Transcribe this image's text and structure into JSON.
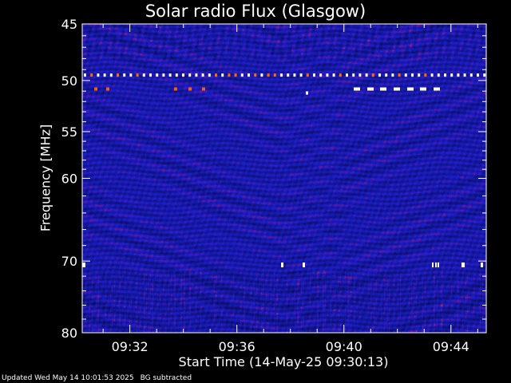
{
  "chart_data": {
    "type": "heatmap",
    "title": "Solar radio Flux (Glasgow)",
    "xlabel": "Start Time (14-May-25 09:30:13)",
    "ylabel": "Frequency [MHz]",
    "x_tick_labels": [
      "09:32",
      "09:36",
      "09:40",
      "09:44"
    ],
    "x_tick_minutes": [
      1.78,
      5.78,
      9.78,
      13.78
    ],
    "xlim_minutes": [
      0,
      15.1
    ],
    "y_ticks": [
      45,
      50,
      55,
      60,
      70,
      80
    ],
    "ylim": [
      80,
      45
    ],
    "minor_y_ticks": [
      46,
      47,
      48,
      49,
      51,
      52,
      53,
      54,
      56,
      57,
      58,
      59,
      62,
      64,
      66,
      68,
      72,
      74,
      76,
      78
    ],
    "colormap": "blue-red-yellow-white",
    "background_color": "#1f1ebc",
    "features": [
      {
        "name": "RFI 49.5 MHz",
        "freq": 49.5,
        "kind": "dotted-line"
      },
      {
        "name": "RFI 50.8 MHz",
        "freq": 50.8,
        "kind": "bursts"
      },
      {
        "name": "RFI 70.5 MHz",
        "freq": 70.5,
        "kind": "spots"
      },
      {
        "name": "noisy band 71-80 MHz",
        "freq_range": [
          71.3,
          80
        ],
        "kind": "band"
      }
    ]
  },
  "footer": {
    "updated": "Updated Wed May 14 10:01:53 2025",
    "note": "BG subtracted"
  }
}
